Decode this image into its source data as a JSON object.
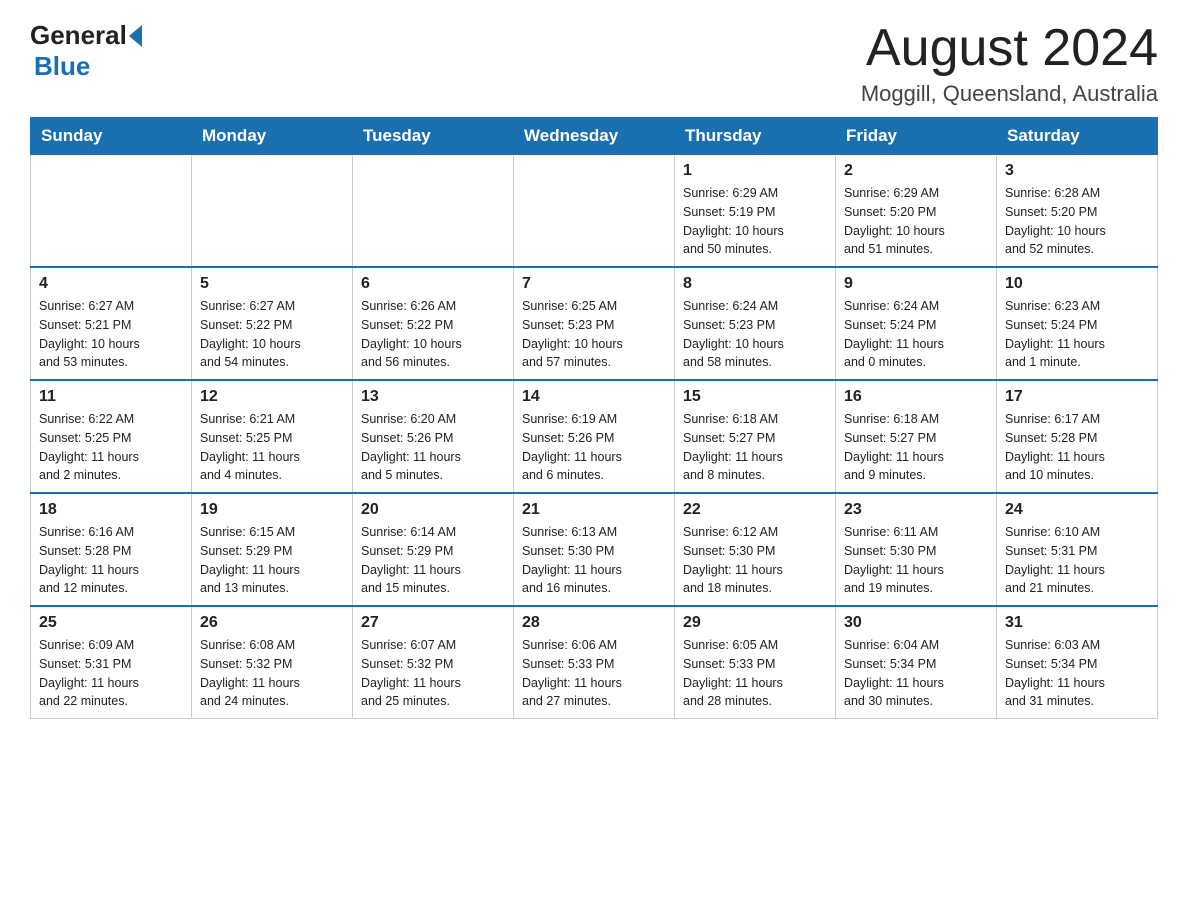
{
  "header": {
    "logo_general": "General",
    "logo_blue": "Blue",
    "month_title": "August 2024",
    "location": "Moggill, Queensland, Australia"
  },
  "calendar": {
    "days_of_week": [
      "Sunday",
      "Monday",
      "Tuesday",
      "Wednesday",
      "Thursday",
      "Friday",
      "Saturday"
    ],
    "weeks": [
      [
        {
          "day": "",
          "info": ""
        },
        {
          "day": "",
          "info": ""
        },
        {
          "day": "",
          "info": ""
        },
        {
          "day": "",
          "info": ""
        },
        {
          "day": "1",
          "info": "Sunrise: 6:29 AM\nSunset: 5:19 PM\nDaylight: 10 hours\nand 50 minutes."
        },
        {
          "day": "2",
          "info": "Sunrise: 6:29 AM\nSunset: 5:20 PM\nDaylight: 10 hours\nand 51 minutes."
        },
        {
          "day": "3",
          "info": "Sunrise: 6:28 AM\nSunset: 5:20 PM\nDaylight: 10 hours\nand 52 minutes."
        }
      ],
      [
        {
          "day": "4",
          "info": "Sunrise: 6:27 AM\nSunset: 5:21 PM\nDaylight: 10 hours\nand 53 minutes."
        },
        {
          "day": "5",
          "info": "Sunrise: 6:27 AM\nSunset: 5:22 PM\nDaylight: 10 hours\nand 54 minutes."
        },
        {
          "day": "6",
          "info": "Sunrise: 6:26 AM\nSunset: 5:22 PM\nDaylight: 10 hours\nand 56 minutes."
        },
        {
          "day": "7",
          "info": "Sunrise: 6:25 AM\nSunset: 5:23 PM\nDaylight: 10 hours\nand 57 minutes."
        },
        {
          "day": "8",
          "info": "Sunrise: 6:24 AM\nSunset: 5:23 PM\nDaylight: 10 hours\nand 58 minutes."
        },
        {
          "day": "9",
          "info": "Sunrise: 6:24 AM\nSunset: 5:24 PM\nDaylight: 11 hours\nand 0 minutes."
        },
        {
          "day": "10",
          "info": "Sunrise: 6:23 AM\nSunset: 5:24 PM\nDaylight: 11 hours\nand 1 minute."
        }
      ],
      [
        {
          "day": "11",
          "info": "Sunrise: 6:22 AM\nSunset: 5:25 PM\nDaylight: 11 hours\nand 2 minutes."
        },
        {
          "day": "12",
          "info": "Sunrise: 6:21 AM\nSunset: 5:25 PM\nDaylight: 11 hours\nand 4 minutes."
        },
        {
          "day": "13",
          "info": "Sunrise: 6:20 AM\nSunset: 5:26 PM\nDaylight: 11 hours\nand 5 minutes."
        },
        {
          "day": "14",
          "info": "Sunrise: 6:19 AM\nSunset: 5:26 PM\nDaylight: 11 hours\nand 6 minutes."
        },
        {
          "day": "15",
          "info": "Sunrise: 6:18 AM\nSunset: 5:27 PM\nDaylight: 11 hours\nand 8 minutes."
        },
        {
          "day": "16",
          "info": "Sunrise: 6:18 AM\nSunset: 5:27 PM\nDaylight: 11 hours\nand 9 minutes."
        },
        {
          "day": "17",
          "info": "Sunrise: 6:17 AM\nSunset: 5:28 PM\nDaylight: 11 hours\nand 10 minutes."
        }
      ],
      [
        {
          "day": "18",
          "info": "Sunrise: 6:16 AM\nSunset: 5:28 PM\nDaylight: 11 hours\nand 12 minutes."
        },
        {
          "day": "19",
          "info": "Sunrise: 6:15 AM\nSunset: 5:29 PM\nDaylight: 11 hours\nand 13 minutes."
        },
        {
          "day": "20",
          "info": "Sunrise: 6:14 AM\nSunset: 5:29 PM\nDaylight: 11 hours\nand 15 minutes."
        },
        {
          "day": "21",
          "info": "Sunrise: 6:13 AM\nSunset: 5:30 PM\nDaylight: 11 hours\nand 16 minutes."
        },
        {
          "day": "22",
          "info": "Sunrise: 6:12 AM\nSunset: 5:30 PM\nDaylight: 11 hours\nand 18 minutes."
        },
        {
          "day": "23",
          "info": "Sunrise: 6:11 AM\nSunset: 5:30 PM\nDaylight: 11 hours\nand 19 minutes."
        },
        {
          "day": "24",
          "info": "Sunrise: 6:10 AM\nSunset: 5:31 PM\nDaylight: 11 hours\nand 21 minutes."
        }
      ],
      [
        {
          "day": "25",
          "info": "Sunrise: 6:09 AM\nSunset: 5:31 PM\nDaylight: 11 hours\nand 22 minutes."
        },
        {
          "day": "26",
          "info": "Sunrise: 6:08 AM\nSunset: 5:32 PM\nDaylight: 11 hours\nand 24 minutes."
        },
        {
          "day": "27",
          "info": "Sunrise: 6:07 AM\nSunset: 5:32 PM\nDaylight: 11 hours\nand 25 minutes."
        },
        {
          "day": "28",
          "info": "Sunrise: 6:06 AM\nSunset: 5:33 PM\nDaylight: 11 hours\nand 27 minutes."
        },
        {
          "day": "29",
          "info": "Sunrise: 6:05 AM\nSunset: 5:33 PM\nDaylight: 11 hours\nand 28 minutes."
        },
        {
          "day": "30",
          "info": "Sunrise: 6:04 AM\nSunset: 5:34 PM\nDaylight: 11 hours\nand 30 minutes."
        },
        {
          "day": "31",
          "info": "Sunrise: 6:03 AM\nSunset: 5:34 PM\nDaylight: 11 hours\nand 31 minutes."
        }
      ]
    ]
  }
}
